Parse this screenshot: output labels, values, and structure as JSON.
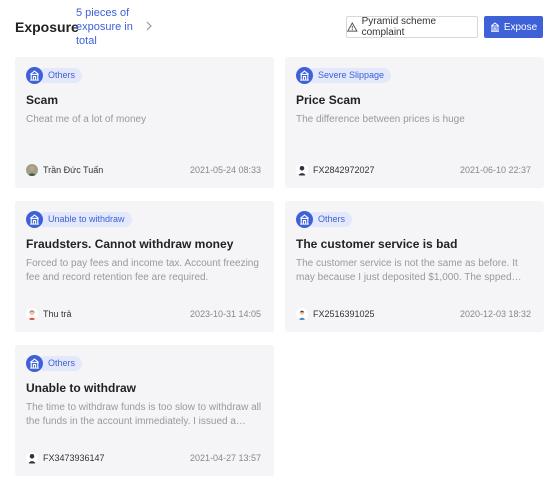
{
  "header": {
    "title": "Exposure",
    "count_text": "5 pieces of exposure in total",
    "complaint_label": "Pyramid scheme complaint",
    "expose_label": "Expose"
  },
  "colors": {
    "accent": "#3e61d8",
    "tag_background": "#e3e8fb",
    "card_background": "#f5f5f7"
  },
  "cards": [
    {
      "tag": "Others",
      "title": "Scam",
      "description": "Cheat me of a lot of money",
      "user": "Trần Đức Tuấn",
      "avatar": "photo-avatar",
      "date": "2021-05-24 08:33"
    },
    {
      "tag": "Severe Slippage",
      "title": "Price Scam",
      "description": "The difference between prices is huge",
      "user": "FX2842972027",
      "avatar": "default-user-avatar",
      "date": "2021-06-10 22:37"
    },
    {
      "tag": "Unable to withdraw",
      "title": "Fraudsters. Cannot withdraw money",
      "description": "Forced to pay fees and income tax. Account freezing fee and record retention fee are required.",
      "user": "Thu trả",
      "avatar": "female-avatar",
      "date": "2023-10-31 14:05"
    },
    {
      "tag": "Others",
      "title": "The customer service is bad",
      "description": "The customer service is not the same as before. It may because I just deposited $1,000. The spped of…",
      "user": "FX2516391025",
      "avatar": "male-avatar",
      "date": "2020-12-03 18:32"
    },
    {
      "tag": "Others",
      "title": "Unable to withdraw",
      "description": "The time to withdraw funds is too slow to withdraw all the funds in the account immediately. I issued a…",
      "user": "FX3473936147",
      "avatar": "default-user-avatar",
      "date": "2021-04-27 13:57"
    }
  ]
}
